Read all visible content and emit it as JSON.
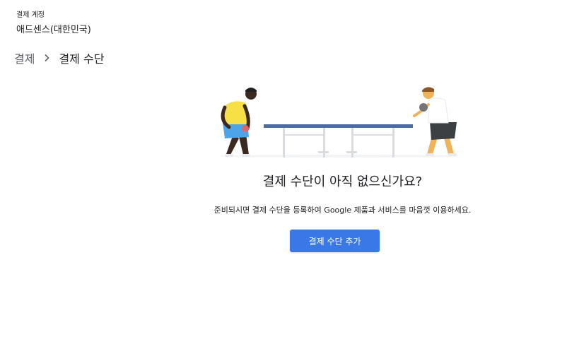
{
  "account": {
    "label": "결제 계정",
    "name": "애드센스(대한민국)"
  },
  "breadcrumb": {
    "root": "결제",
    "current": "결제 수단"
  },
  "empty_state": {
    "title": "결제 수단이 아직 없으신가요?",
    "description": "준비되시면 결제 수단을 등록하여 Google 제품과 서비스를 마음껏 이용하세요.",
    "button_label": "결제 수단 추가"
  },
  "colors": {
    "button": "#3b78e7",
    "table_top": "#4a6ba3",
    "table_legs": "#dadce0"
  }
}
